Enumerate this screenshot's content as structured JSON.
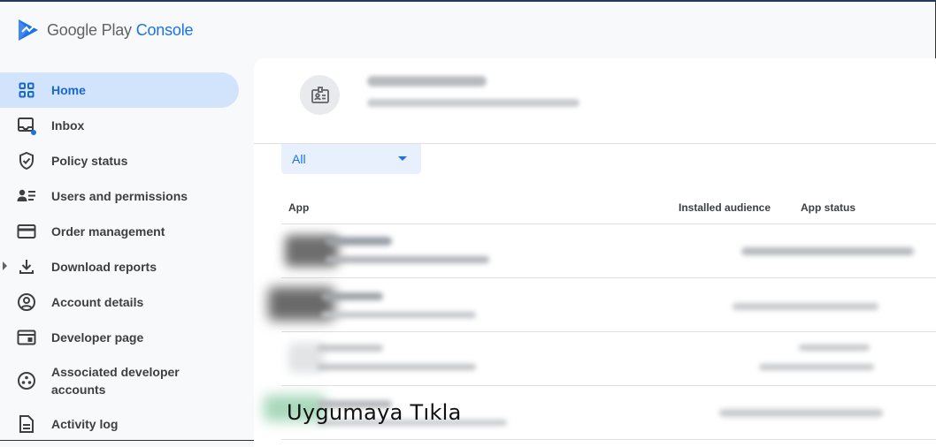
{
  "brand": {
    "name_part1": "Google Play",
    "name_part2": "Console"
  },
  "nav": {
    "home": "Home",
    "inbox": "Inbox",
    "policy_status": "Policy status",
    "users_permissions": "Users and permissions",
    "order_management": "Order management",
    "download_reports": "Download reports",
    "account_details": "Account details",
    "developer_page": "Developer page",
    "associated_accounts_line1": "Associated developer",
    "associated_accounts_line2": "accounts",
    "activity_log": "Activity log"
  },
  "filter": {
    "value": "All"
  },
  "table": {
    "headers": {
      "app": "App",
      "installed_audience": "Installed audience",
      "app_status": "App status"
    },
    "row_count": 4
  },
  "overlay_caption": "Uygumaya Tıkla",
  "colors": {
    "accent": "#1a73e8",
    "active_bg": "#d2e3fc",
    "sidebar_bg": "#f8f9fa"
  }
}
